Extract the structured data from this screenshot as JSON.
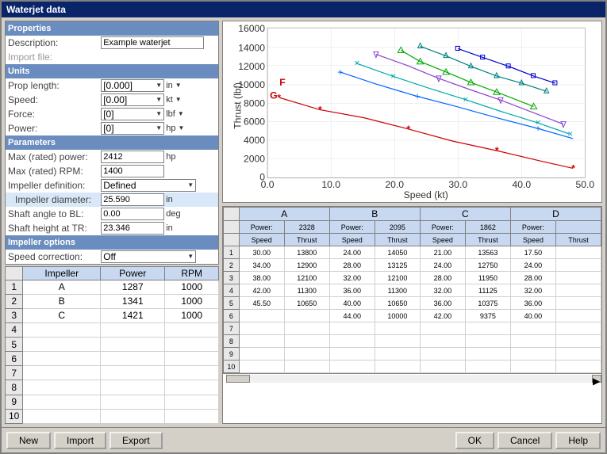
{
  "window": {
    "title": "Waterjet data"
  },
  "properties": {
    "section": "Properties",
    "description_label": "Description:",
    "description_value": "Example waterjet",
    "import_label": "Import file:",
    "import_value": ""
  },
  "units": {
    "section": "Units",
    "prop_length_label": "Prop length:",
    "prop_length_value": "[0.000]",
    "prop_length_unit": "in",
    "speed_label": "Speed:",
    "speed_value": "[0.00]",
    "speed_unit": "kt",
    "force_label": "Force:",
    "force_value": "[0]",
    "force_unit": "lbf",
    "power_label": "Power:",
    "power_value": "[0]",
    "power_unit": "hp"
  },
  "parameters": {
    "section": "Parameters",
    "max_power_label": "Max (rated) power:",
    "max_power_value": "2412",
    "max_power_unit": "hp",
    "max_rpm_label": "Max (rated) RPM:",
    "max_rpm_value": "1400",
    "impeller_def_label": "Impeller definition:",
    "impeller_def_value": "Defined",
    "impeller_dia_label": "Impeller diameter:",
    "impeller_dia_value": "25.590",
    "impeller_dia_unit": "in",
    "shaft_angle_label": "Shaft angle to BL:",
    "shaft_angle_value": "0.00",
    "shaft_angle_unit": "deg",
    "shaft_height_label": "Shaft height at TR:",
    "shaft_height_value": "23.346",
    "shaft_height_unit": "in"
  },
  "impeller_options": {
    "section": "Impeller options",
    "speed_correction_label": "Speed correction:",
    "speed_correction_value": "Off"
  },
  "impeller_table": {
    "col_row": "",
    "col_impeller": "Impeller",
    "col_power": "Power",
    "col_rpm": "RPM",
    "rows": [
      {
        "num": "1",
        "impeller": "A",
        "power": "1287",
        "rpm": "1000"
      },
      {
        "num": "2",
        "impeller": "B",
        "power": "1341",
        "rpm": "1000"
      },
      {
        "num": "3",
        "impeller": "C",
        "power": "1421",
        "rpm": "1000"
      },
      {
        "num": "4",
        "impeller": "",
        "power": "",
        "rpm": ""
      },
      {
        "num": "5",
        "impeller": "",
        "power": "",
        "rpm": ""
      },
      {
        "num": "6",
        "impeller": "",
        "power": "",
        "rpm": ""
      },
      {
        "num": "7",
        "impeller": "",
        "power": "",
        "rpm": ""
      },
      {
        "num": "8",
        "impeller": "",
        "power": "",
        "rpm": ""
      },
      {
        "num": "9",
        "impeller": "",
        "power": "",
        "rpm": ""
      },
      {
        "num": "10",
        "impeller": "",
        "power": "",
        "rpm": ""
      }
    ]
  },
  "data_grid": {
    "col_a_power": "2328",
    "col_b_power": "2095",
    "col_c_power": "1862",
    "col_d_power": "",
    "col_a_label": "A",
    "col_b_label": "B",
    "col_c_label": "C",
    "col_d_label": "D",
    "speed_label": "Speed",
    "thrust_label": "Thrust",
    "rows": [
      {
        "num": "1",
        "a_speed": "30.00",
        "a_thrust": "13800",
        "b_speed": "24.00",
        "b_thrust": "14050",
        "c_speed": "21.00",
        "c_thrust": "13563",
        "d_speed": "17.50"
      },
      {
        "num": "2",
        "a_speed": "34.00",
        "a_thrust": "12900",
        "b_speed": "28.00",
        "b_thrust": "13125",
        "c_speed": "24.00",
        "c_thrust": "12750",
        "d_speed": "24.00"
      },
      {
        "num": "3",
        "a_speed": "38.00",
        "a_thrust": "12100",
        "b_speed": "32.00",
        "b_thrust": "12100",
        "c_speed": "28.00",
        "c_thrust": "11950",
        "d_speed": "28.00"
      },
      {
        "num": "4",
        "a_speed": "42.00",
        "a_thrust": "11300",
        "b_speed": "36.00",
        "b_thrust": "11300",
        "c_speed": "32.00",
        "c_thrust": "11125",
        "d_speed": "32.00"
      },
      {
        "num": "5",
        "a_speed": "45.50",
        "a_thrust": "10650",
        "b_speed": "40.00",
        "b_thrust": "10650",
        "c_speed": "36.00",
        "c_thrust": "10375",
        "d_speed": "36.00"
      },
      {
        "num": "6",
        "a_speed": "",
        "a_thrust": "",
        "b_speed": "44.00",
        "b_thrust": "10000",
        "c_speed": "42.00",
        "c_thrust": "9375",
        "d_speed": "40.00"
      },
      {
        "num": "7",
        "a_speed": "",
        "a_thrust": "",
        "b_speed": "",
        "b_thrust": "",
        "c_speed": "",
        "c_thrust": "",
        "d_speed": ""
      },
      {
        "num": "8",
        "a_speed": "",
        "a_thrust": "",
        "b_speed": "",
        "b_thrust": "",
        "c_speed": "",
        "c_thrust": "",
        "d_speed": ""
      },
      {
        "num": "9",
        "a_speed": "",
        "a_thrust": "",
        "b_speed": "",
        "b_thrust": "",
        "c_speed": "",
        "c_thrust": "",
        "d_speed": ""
      },
      {
        "num": "10",
        "a_speed": "",
        "a_thrust": "",
        "b_speed": "",
        "b_thrust": "",
        "c_speed": "",
        "c_thrust": "",
        "d_speed": ""
      }
    ]
  },
  "chart": {
    "y_label": "Thrust (lbf)",
    "x_label": "Speed (kt)",
    "y_max": "16000",
    "y_ticks": [
      "16000",
      "14000",
      "12000",
      "10000",
      "8000",
      "6000",
      "4000",
      "2000",
      "0"
    ],
    "x_ticks": [
      "0.0",
      "10.0",
      "20.0",
      "30.0",
      "40.0",
      "50.0"
    ]
  },
  "buttons": {
    "new": "New",
    "import": "Import",
    "export": "Export",
    "ok": "OK",
    "cancel": "Cancel",
    "help": "Help"
  }
}
